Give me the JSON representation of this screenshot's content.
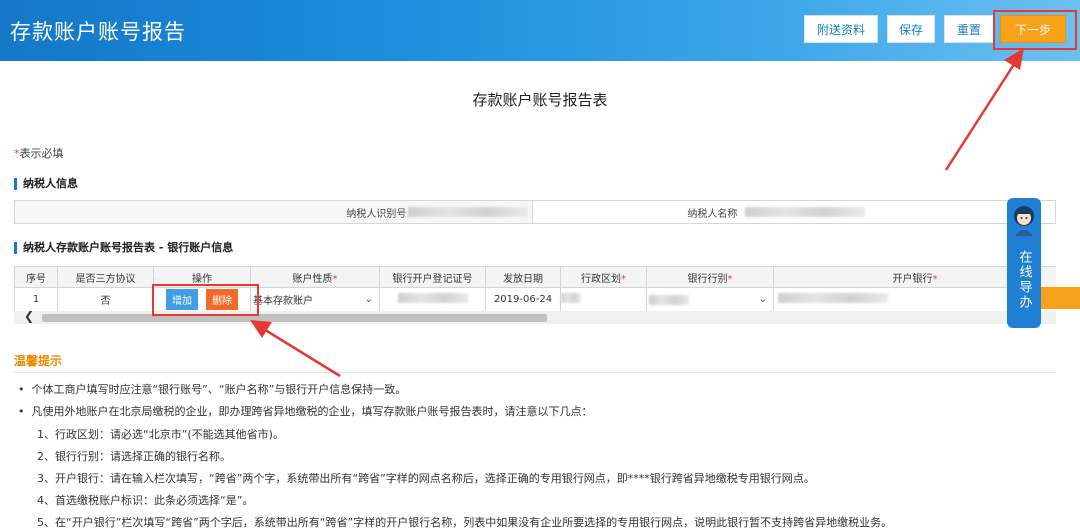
{
  "header": {
    "title": "存款账户账号报告",
    "buttons": {
      "attach": "附送资料",
      "save": "保存",
      "reset": "重置",
      "next": "下一步"
    }
  },
  "page_title": "存款账户账号报告表",
  "required_note": {
    "star": "*",
    "text": "表示必填"
  },
  "taxpayer_section": {
    "title": "纳税人信息",
    "id_label": "纳税人识别号",
    "name_label": "纳税人名称"
  },
  "bank_section": {
    "title": "纳税人存款账户账号报告表 - 银行账户信息",
    "headers": [
      "序号",
      "是否三方协议",
      "操作",
      "账户性质",
      "银行开户登记证号",
      "发放日期",
      "行政区划",
      "银行行别",
      "开户银行"
    ],
    "required_star": "*",
    "row": {
      "index": "1",
      "three_party": "否",
      "add": "增加",
      "delete": "删除",
      "account_type": "基本存款账户",
      "issue_date": "2019-06-24"
    }
  },
  "help": {
    "label": "在线导办"
  },
  "tips": {
    "title": "温馨提示",
    "bullet1": "个体工商户填写时应注意“银行账号”、“账户名称”与银行开户信息保持一致。",
    "bullet2": "凡使用外地账户在北京局缴税的企业，即办理跨省异地缴税的企业，填写存款账户账号报告表时，请注意以下几点：",
    "item1": "1、行政区划：请必选“北京市”(不能选其他省市)。",
    "item2": "2、银行行别：请选择正确的银行名称。",
    "item3": "3、开户银行：请在输入栏次填写，“跨省”两个字，系统带出所有“跨省”字样的网点名称后，选择正确的专用银行网点，即****银行跨省异地缴税专用银行网点。",
    "item4": "4、首选缴税账户标识：此条必须选择“是”。",
    "item5": "5、在“开户银行”栏次填写“跨省”两个字后，系统带出所有“跨省”字样的开户银行名称，列表中如果没有企业所要选择的专用银行网点，说明此银行暂不支持跨省异地缴税业务。"
  },
  "colors": {
    "header_blue": "#1577c8",
    "next_orange": "#f7a21a",
    "annotation_red": "#e53935"
  }
}
